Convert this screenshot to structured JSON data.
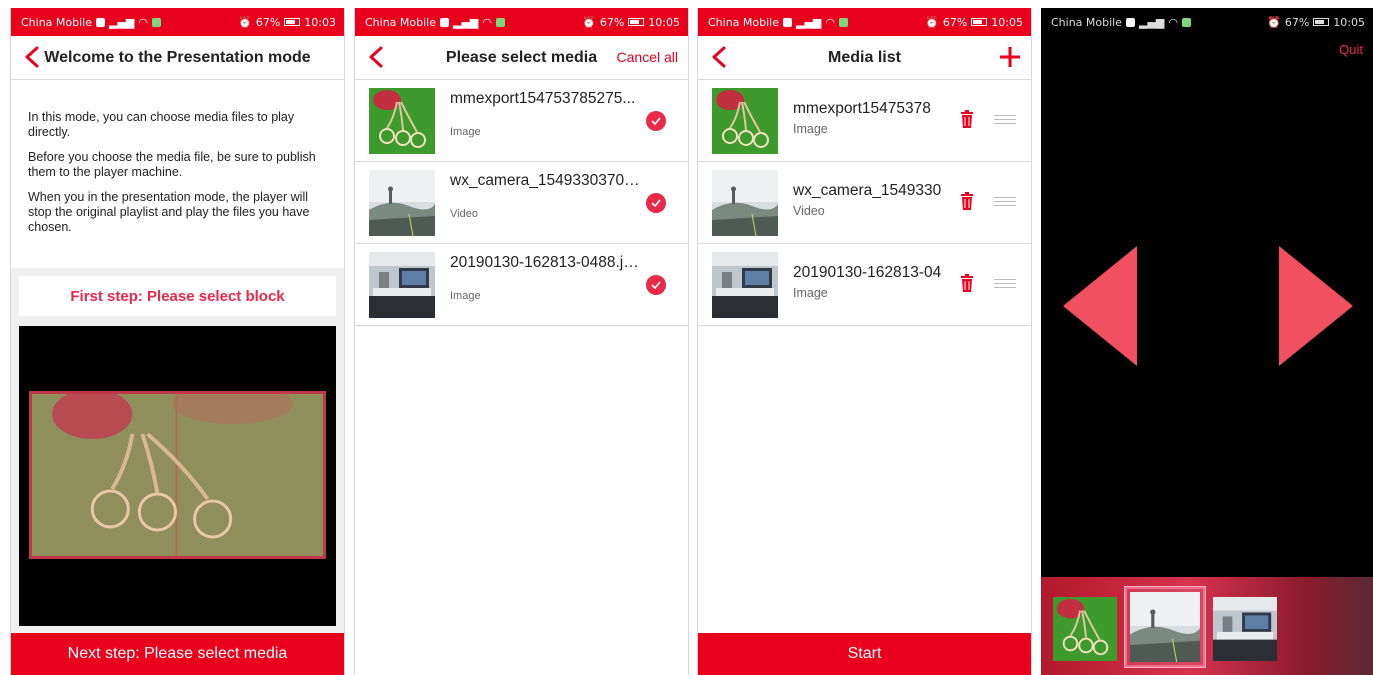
{
  "status_bar": {
    "carrier": "China Mobile",
    "battery": "67%",
    "times": [
      "10:03",
      "10:05",
      "10:05",
      "10:05"
    ]
  },
  "screen1": {
    "title": "Welcome to the Presentation mode",
    "paragraphs": [
      "In this mode, you can choose media files to play directly.",
      "Before you choose the media file, be sure to publish them to the player machine.",
      "When you in the presentation mode, the player will stop the original playlist and play the files you have chosen."
    ],
    "first_step": "First step: Please select block",
    "next_button": "Next step: Please select media"
  },
  "screen2": {
    "title": "Please select media",
    "cancel_all": "Cancel all",
    "items": [
      {
        "name": "mmexport154753785275...",
        "type": "Image",
        "thumb": "green-drops"
      },
      {
        "name": "wx_camera_15493303704...",
        "type": "Video",
        "thumb": "hill-statue"
      },
      {
        "name": "20190130-162813-0488.jpg",
        "type": "Image",
        "thumb": "office"
      }
    ]
  },
  "screen3": {
    "title": "Media list",
    "items": [
      {
        "name": "mmexport15475378",
        "type": "Image"
      },
      {
        "name": "wx_camera_1549330",
        "type": "Video"
      },
      {
        "name": "20190130-162813-04",
        "type": "Image"
      }
    ],
    "start_button": "Start"
  },
  "screen4": {
    "quit": "Quit"
  },
  "colors": {
    "accent": "#e8001c",
    "accent_soft": "#e8294a",
    "arrow": "#f0505f"
  }
}
